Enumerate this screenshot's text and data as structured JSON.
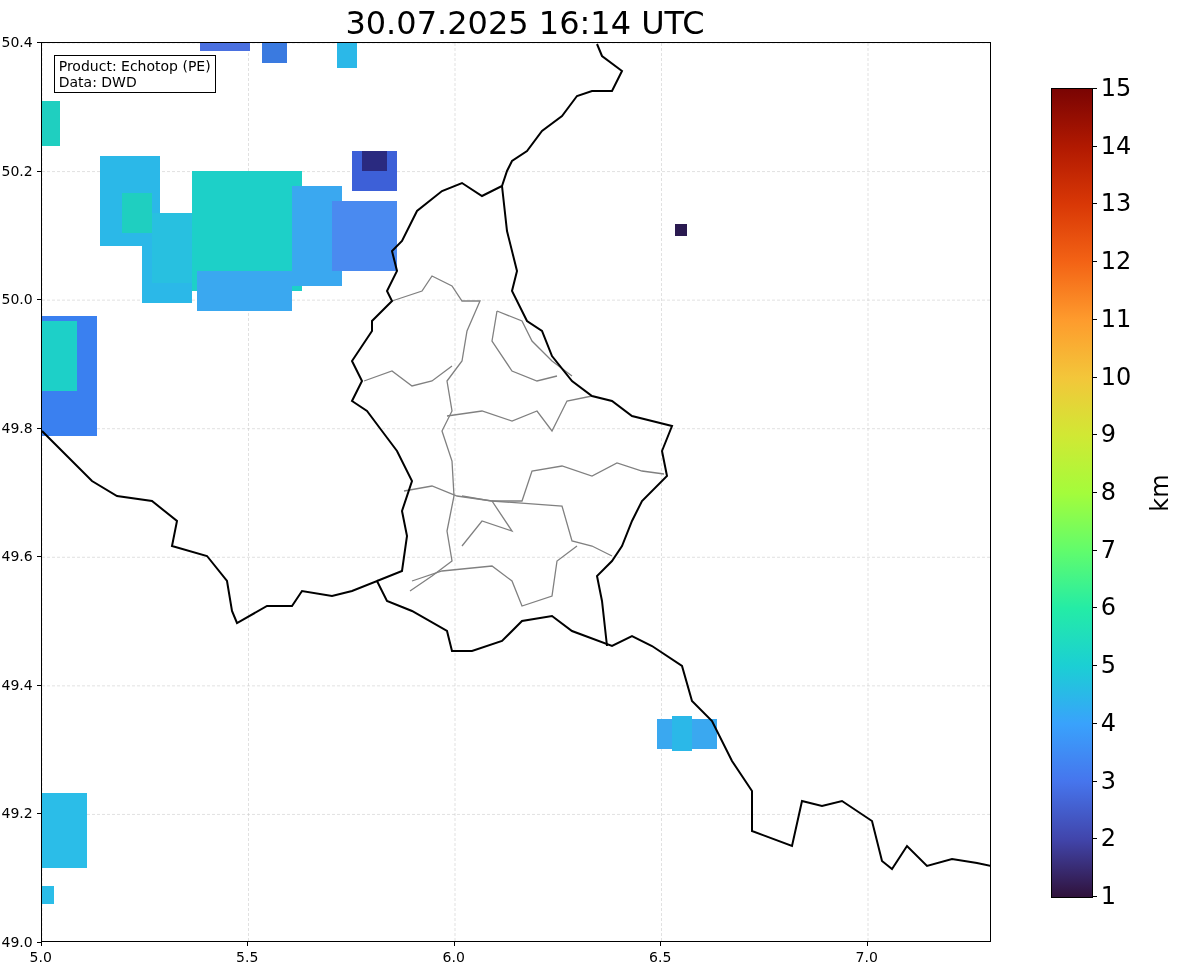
{
  "title": "30.07.2025 16:14 UTC",
  "info_box": [
    "Product: Echotop (PE)",
    "Data: DWD"
  ],
  "map": {
    "xticks": [
      "5.0",
      "5.5",
      "6.0",
      "6.5",
      "7.0"
    ],
    "yticks": [
      "50.4",
      "50.2",
      "50.0",
      "49.8",
      "49.6",
      "49.4",
      "49.2",
      "49.0"
    ]
  },
  "colorbar": {
    "label": "km",
    "ticks": [
      "15",
      "14",
      "13",
      "12",
      "11",
      "10",
      "9",
      "8",
      "7",
      "6",
      "5",
      "4",
      "3",
      "2",
      "1"
    ]
  }
}
